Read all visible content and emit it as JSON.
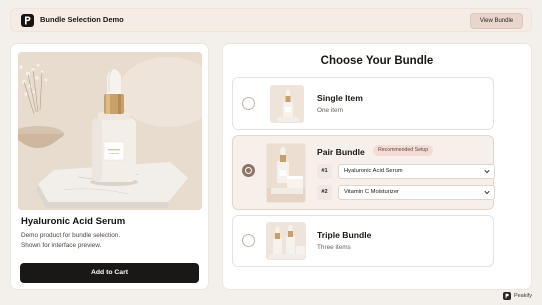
{
  "header": {
    "app_title": "Bundle Selection Demo",
    "view_bundle_label": "View Bundle",
    "logo_icon": "p-logo-icon"
  },
  "product": {
    "name": "Hyaluronic Acid Serum",
    "description_line1": "Demo product for bundle selection.",
    "description_line2": "Shown for interface preview.",
    "cart_label": "Add to Cart"
  },
  "bundles": {
    "title": "Choose Your Bundle",
    "options": [
      {
        "title": "Single Item",
        "subtitle": "One item",
        "selected": false
      },
      {
        "title": "Pair Bundle",
        "badge": "Recommended Setup",
        "selected": true,
        "items": [
          {
            "num": "#1",
            "value": "Hyaluronic Acid Serum"
          },
          {
            "num": "#2",
            "value": "Vitamin C Moisturizer"
          }
        ]
      },
      {
        "title": "Triple Bundle",
        "subtitle": "Three items",
        "selected": false
      }
    ]
  },
  "footer": {
    "brand": "Peakify"
  },
  "colors": {
    "accent": "#8f7466",
    "badge_bg": "#f4dcd5",
    "button_dark": "#1a1816",
    "page_bg": "#f3efeb"
  }
}
